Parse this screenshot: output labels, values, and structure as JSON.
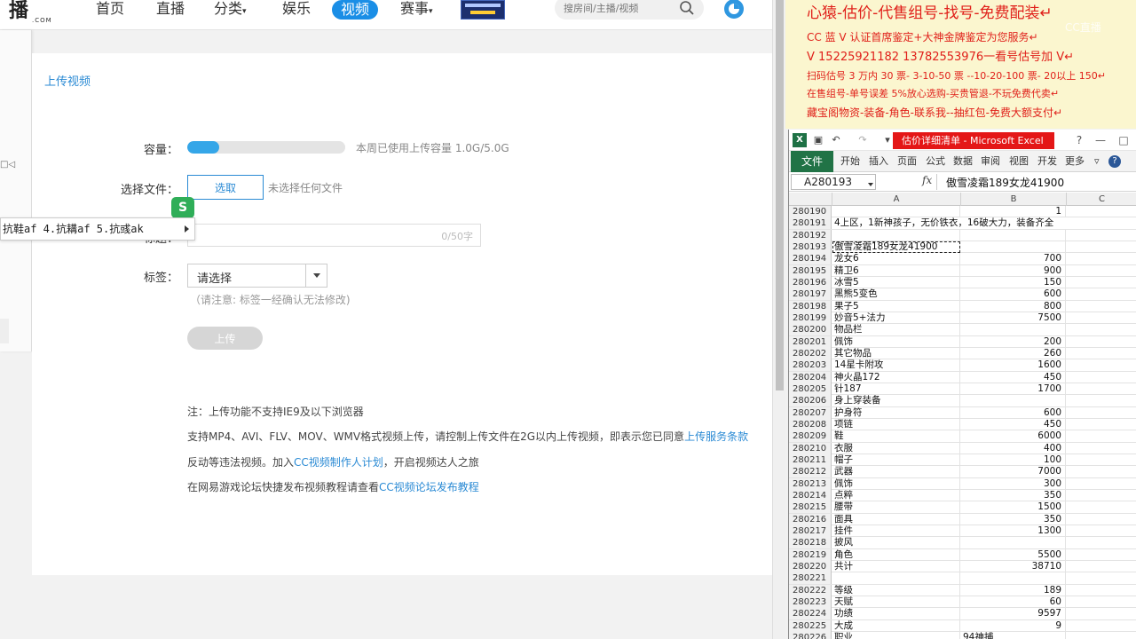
{
  "site": {
    "logo_text": "播",
    "logo_sub": ".COM",
    "nav": [
      "首页",
      "直播",
      "分类",
      "娱乐",
      "视频",
      "赛事"
    ],
    "search_placeholder": "搜房间/主播/视频"
  },
  "upload": {
    "page_title": "上传视频",
    "capacity_label": "容量：",
    "capacity_used_fraction": 0.2,
    "capacity_text": "本周已使用上传容量 1.0G/5.0G",
    "file_label": "选择文件：",
    "pick_button": "选取",
    "no_file": "未选择任何文件",
    "title_label": "标题：",
    "char_count": "0/50字",
    "tag_label": "标签：",
    "tag_select": "请选择",
    "tag_note": "（请注意: 标签一经确认无法修改)",
    "upload_button": "上传",
    "notes": {
      "n1": "注：上传功能不支持IE9及以下浏览器",
      "n2_pre": "支持MP4、AVI、FLV、MOV、WMV格式视频上传，请控制上传文件在2G以内上传视频，即表示您已同意",
      "n2_link": "上传服务条款",
      "n3_pre": "反动等违法视频。加入",
      "n3_link": "CC视频制作人计划",
      "n3_post": "，开启视频达人之旅",
      "n4_pre": "在网易游戏论坛快捷发布视频教程请查看",
      "n4_link": "CC视频论坛发布教程"
    }
  },
  "ime": {
    "candidates": "抗鞋af 4.抗耩af 5.抗彧ak",
    "logo": "S"
  },
  "overlay": {
    "lines": [
      "心猿-估价-代售组号-找号-免费配装↵",
      "CC 蓝 V 认证首席鉴定+大神金牌鉴定为您服务↵",
      "V 15225921182      13782553976一看号估号加 V↵",
      "扫码估号 3 万内 30 票- 3-10-50 票 --10-20-100 票- 20以上 150↵",
      "在售组号-单号误差 5%放心选购-买贵管退-不玩免费代卖↵",
      "藏宝阁物资-装备-角色-联系我--抽红包-免费大额支付↵"
    ],
    "watermark": "CC直播"
  },
  "excel": {
    "title": "估价详细清单 - Microsoft Excel",
    "ribbon_file": "文件",
    "ribbon_tabs": [
      "开始",
      "插入",
      "页面",
      "公式",
      "数据",
      "审阅",
      "视图",
      "开发",
      "更多"
    ],
    "name_box": "A280193",
    "fx": "fx",
    "formula": "傲雪凌霜189女龙41900",
    "columns": [
      "A",
      "B",
      "C"
    ],
    "rows": [
      {
        "n": "280190",
        "a": "",
        "b": "1"
      },
      {
        "n": "280191",
        "a": "4上区，1新神孩子，无价铁衣，16破大力，装备齐全",
        "b": ""
      },
      {
        "n": "280192",
        "a": "",
        "b": ""
      },
      {
        "n": "280193",
        "a": "傲雪凌霜189女龙41900",
        "b": ""
      },
      {
        "n": "280194",
        "a": "龙女6",
        "b": "700"
      },
      {
        "n": "280195",
        "a": "精卫6",
        "b": "900"
      },
      {
        "n": "280196",
        "a": "冰雪5",
        "b": "150"
      },
      {
        "n": "280197",
        "a": "黑熊5变色",
        "b": "600"
      },
      {
        "n": "280198",
        "a": "果子5",
        "b": "800"
      },
      {
        "n": "280199",
        "a": "妙音5+法力",
        "b": "7500"
      },
      {
        "n": "280200",
        "a": "物品栏",
        "b": ""
      },
      {
        "n": "280201",
        "a": "佩饰",
        "b": "200"
      },
      {
        "n": "280202",
        "a": "其它物品",
        "b": "260"
      },
      {
        "n": "280203",
        "a": "14星卡附攻",
        "b": "1600"
      },
      {
        "n": "280204",
        "a": "神火晶172",
        "b": "450"
      },
      {
        "n": "280205",
        "a": "针187",
        "b": "1700"
      },
      {
        "n": "280206",
        "a": "身上穿装备",
        "b": ""
      },
      {
        "n": "280207",
        "a": "护身符",
        "b": "600"
      },
      {
        "n": "280208",
        "a": "项链",
        "b": "450"
      },
      {
        "n": "280209",
        "a": "鞋",
        "b": "6000"
      },
      {
        "n": "280210",
        "a": "衣服",
        "b": "400"
      },
      {
        "n": "280211",
        "a": "帽子",
        "b": "100"
      },
      {
        "n": "280212",
        "a": "武器",
        "b": "7000"
      },
      {
        "n": "280213",
        "a": "佩饰",
        "b": "300"
      },
      {
        "n": "280214",
        "a": "点粹",
        "b": "350"
      },
      {
        "n": "280215",
        "a": "腰带",
        "b": "1500"
      },
      {
        "n": "280216",
        "a": "面具",
        "b": "350"
      },
      {
        "n": "280217",
        "a": "挂件",
        "b": "1300"
      },
      {
        "n": "280218",
        "a": "披风",
        "b": ""
      },
      {
        "n": "280219",
        "a": "角色",
        "b": "5500"
      },
      {
        "n": "280220",
        "a": "共计",
        "b": "38710"
      },
      {
        "n": "280221",
        "a": "",
        "b": ""
      },
      {
        "n": "280222",
        "a": "等级",
        "b": "189"
      },
      {
        "n": "280223",
        "a": "天赋",
        "b": "60"
      },
      {
        "n": "280224",
        "a": "功绩",
        "b": "9597"
      },
      {
        "n": "280225",
        "a": "大成",
        "b": "9"
      },
      {
        "n": "280226",
        "a": "职业",
        "b": "94神捕"
      }
    ]
  }
}
